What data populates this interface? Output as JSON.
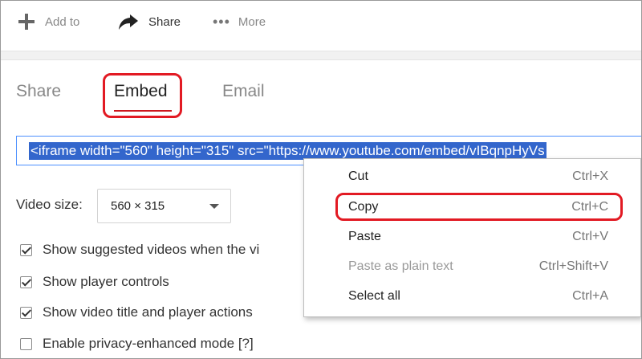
{
  "action_bar": {
    "add_label": "Add to",
    "share_label": "Share",
    "more_label": "More"
  },
  "tabs": [
    {
      "label": "Share"
    },
    {
      "label": "Embed"
    },
    {
      "label": "Email"
    }
  ],
  "embed_code": "<iframe width=\"560\" height=\"315\" src=\"https://www.youtube.com/embed/vIBqnpHyVs",
  "video_size": {
    "label": "Video size:",
    "value": "560 × 315"
  },
  "options": [
    {
      "label": "Show suggested videos when the vi",
      "checked": true
    },
    {
      "label": "Show player controls",
      "checked": true
    },
    {
      "label": "Show video title and player actions",
      "checked": true
    },
    {
      "label": "Enable privacy-enhanced mode [?]",
      "checked": false
    }
  ],
  "context_menu": [
    {
      "label": "Cut",
      "shortcut": "Ctrl+X",
      "enabled": true
    },
    {
      "label": "Copy",
      "shortcut": "Ctrl+C",
      "enabled": true
    },
    {
      "label": "Paste",
      "shortcut": "Ctrl+V",
      "enabled": true
    },
    {
      "label": "Paste as plain text",
      "shortcut": "Ctrl+Shift+V",
      "enabled": false
    },
    {
      "label": "Select all",
      "shortcut": "Ctrl+A",
      "enabled": true
    }
  ],
  "colors": {
    "highlight_red": "#e21a23",
    "selection_blue": "#3366cc",
    "tab_underline": "#cc181e"
  }
}
